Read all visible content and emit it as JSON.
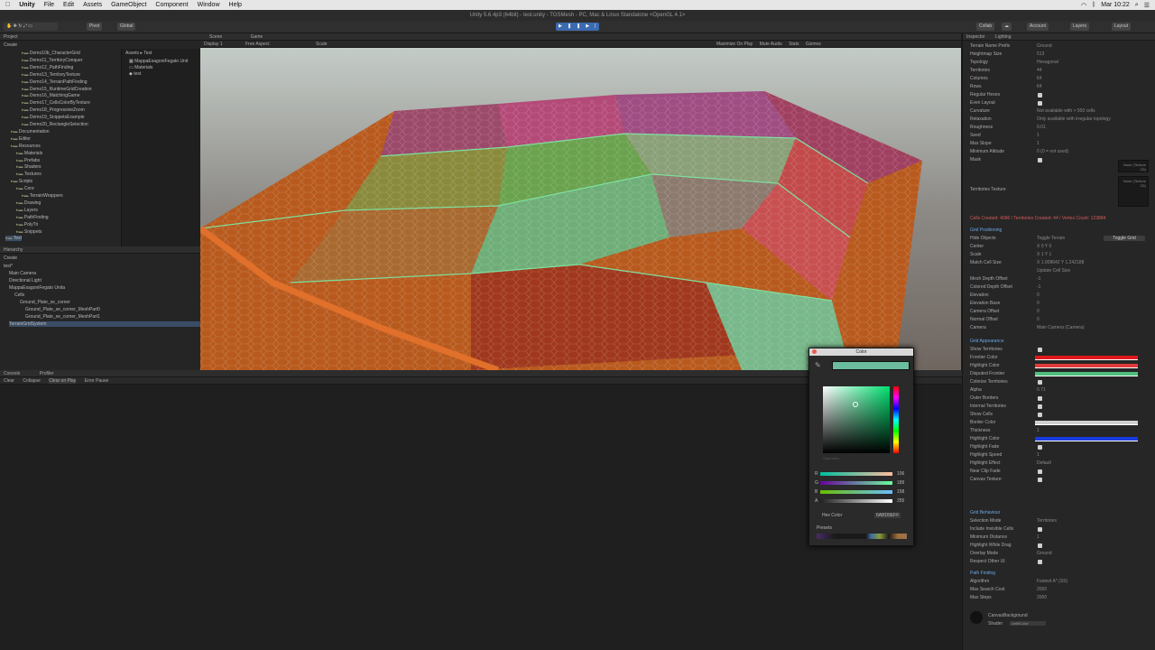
{
  "menubar": {
    "app": "Unity",
    "items": [
      "File",
      "Edit",
      "Assets",
      "GameObject",
      "Component",
      "Window",
      "Help"
    ],
    "clock": "Mar 10:22"
  },
  "window_title": "Unity 5.6.4p3 (64bit) - test.unity - TGSMesh - PC, Mac & Linux Standalone <OpenGL 4.1>",
  "toolbar": {
    "pivot": "Pivot",
    "global": "Global",
    "collab": "Collab",
    "account": "Account",
    "layers": "Layers",
    "layout": "Layout"
  },
  "project": {
    "tab": "Project",
    "create": "Create",
    "assets_path": "Assets ▸ Test",
    "tree": [
      "Demo10b_CharacterGrid",
      "Demo11_TerritoryConquer",
      "Demo12_PathFinding",
      "Demo13_TerritoryTexture",
      "Demo14_TerrainPathFinding",
      "Demo15_RuntimeGridCreation",
      "Demo16_MatchingGame",
      "Demo17_CellsColorByTexture",
      "Demo18_ProgressiveZoom",
      "Demo19_SnippetsExample",
      "Demo20_RectangleSelection",
      "Documentation",
      "Editor",
      "Resources",
      "Materials",
      "Prefabs",
      "Shaders",
      "Textures",
      "Scripts",
      "Core",
      "TerrainWrappers",
      "Drawing",
      "Layers",
      "PathFinding",
      "PolyTri",
      "Snippets",
      "Test"
    ],
    "assets": [
      "MappaEsagoniFegato Unit",
      "Materials",
      "test"
    ]
  },
  "hierarchy": {
    "tab": "Hierarchy",
    "create": "Create",
    "items": [
      "test*",
      "Main Camera",
      "Directional Light",
      "MappaEsagoniFegato Unita",
      "Cells",
      "Ground_Plate_se_corner",
      "Ground_Plate_se_corner_MeshPart0",
      "Ground_Plate_se_corner_MeshPart1",
      "TerrainGridSystem"
    ]
  },
  "scene": {
    "tab_scene": "Scene",
    "tab_game": "Game",
    "display": "Display 1",
    "aspect": "Free Aspect",
    "scale": "Scale",
    "maximize": "Maximize On Play",
    "mute": "Mute Audio",
    "stats": "Stats",
    "gizmos": "Gizmos"
  },
  "console": {
    "tab": "Console",
    "profiler": "Profiler",
    "clear": "Clear",
    "collapse": "Collapse",
    "clear_on_play": "Clear on Play",
    "error_pause": "Error Pause"
  },
  "inspector": {
    "tab": "Inspector",
    "lighting": "Lighting",
    "rows": [
      {
        "label": "Terrain Name Prefix",
        "value": "Ground"
      },
      {
        "label": "Heightmap Size",
        "value": "513"
      },
      {
        "label": "Topology",
        "value": "Hexagonal"
      },
      {
        "label": "Territories",
        "value": "44"
      },
      {
        "label": "Columns",
        "value": "64"
      },
      {
        "label": "Rows",
        "value": "64"
      },
      {
        "label": "Regular Hexes",
        "value": ""
      },
      {
        "label": "Even Layout",
        "value": ""
      },
      {
        "label": "Curvature",
        "value": "Not available with > 500 cells"
      },
      {
        "label": "Relaxation",
        "value": "Only available with irregular topology"
      },
      {
        "label": "Roughness",
        "value": "0.01"
      },
      {
        "label": "Seed",
        "value": "1"
      },
      {
        "label": "Max Slope",
        "value": "1"
      },
      {
        "label": "Minimum Altitude",
        "value": "0  (0 = not used)"
      },
      {
        "label": "Mask",
        "value": ""
      }
    ],
    "territories_texture": "Territories Texture",
    "none_texture": "None (Texture 2D)",
    "select": "Select",
    "cells_info": "Cells Created: 4096 / Territories Created: 44 / Vertex Count: 123884",
    "grid_positioning": "Grid Positioning",
    "pos_rows": [
      {
        "label": "Hide Objects",
        "value": "Toggle Terrain"
      },
      {
        "label": "Center",
        "value": "X 0     Y 0"
      },
      {
        "label": "Scale",
        "value": "X 1     Y 1"
      },
      {
        "label": "Match Cell Size",
        "value": "X 1.008642   Y 1.242188"
      },
      {
        "label": "",
        "value": "Update Cell Size"
      },
      {
        "label": "Mesh Depth Offset",
        "value": "-1"
      },
      {
        "label": "Colored Depth Offset",
        "value": "-1"
      },
      {
        "label": "Elevation",
        "value": "0"
      },
      {
        "label": "Elevation Base",
        "value": "0"
      },
      {
        "label": "Camera Offset",
        "value": "0"
      },
      {
        "label": "Normal Offset",
        "value": "0"
      },
      {
        "label": "Camera",
        "value": "Main Camera (Camera)"
      }
    ],
    "toggle_grid": "Toggle Grid",
    "grid_appearance": "Grid Appearance",
    "app_rows": [
      {
        "label": "Show Territories",
        "value": ""
      },
      {
        "label": "Frontier Color",
        "value": ""
      },
      {
        "label": "Highlight Color",
        "value": ""
      },
      {
        "label": "Disputed Frontier",
        "value": ""
      },
      {
        "label": "Colorize Territories",
        "value": ""
      },
      {
        "label": "Alpha",
        "value": "0.71"
      },
      {
        "label": "Outer Borders",
        "value": ""
      },
      {
        "label": "Internal Territories",
        "value": ""
      },
      {
        "label": "Show Cells",
        "value": ""
      },
      {
        "label": "Border Color",
        "value": ""
      },
      {
        "label": "Thickness",
        "value": "1"
      },
      {
        "label": "Highlight Color",
        "value": ""
      },
      {
        "label": "Highlight Fade",
        "value": ""
      },
      {
        "label": "Highlight Speed",
        "value": "1"
      },
      {
        "label": "Highlight Effect",
        "value": "Default"
      },
      {
        "label": "Near Clip Fade",
        "value": ""
      },
      {
        "label": "Canvas Texture",
        "value": ""
      }
    ],
    "grid_behaviour": "Grid Behaviour",
    "beh_rows": [
      {
        "label": "Selection Mode",
        "value": "Territories"
      },
      {
        "label": "Include Invisible Cells",
        "value": ""
      },
      {
        "label": "Minimum Distance",
        "value": "1"
      },
      {
        "label": "Highlight While Drag",
        "value": ""
      },
      {
        "label": "Overlay Mode",
        "value": "Ground"
      },
      {
        "label": "Respect Other UI",
        "value": ""
      }
    ],
    "path_finding": "Path Finding",
    "pf_rows": [
      {
        "label": "Algorithm",
        "value": "Fastest A* (SS)"
      },
      {
        "label": "Max Search Cost",
        "value": "2000"
      },
      {
        "label": "Max Steps",
        "value": "2000"
      }
    ],
    "canvas_bg": "CanvasBackground",
    "shader": "Shader",
    "shader_value": "Unlit/Color"
  },
  "colorpicker": {
    "title": "Color",
    "r": "106",
    "g": "189",
    "b": "158",
    "a": "255",
    "hex_label": "Hex Color",
    "hex_value": "6ABD9EFF",
    "presets": "Presets",
    "saturation": "Saturation"
  },
  "colors": {
    "selected": "#6abd9e",
    "frontier": "#e0181c",
    "highlight": "#e03a3a",
    "disputed": "#4fc07e",
    "border": "#cfcfcf",
    "cell_highlight": "#1a3be0"
  }
}
